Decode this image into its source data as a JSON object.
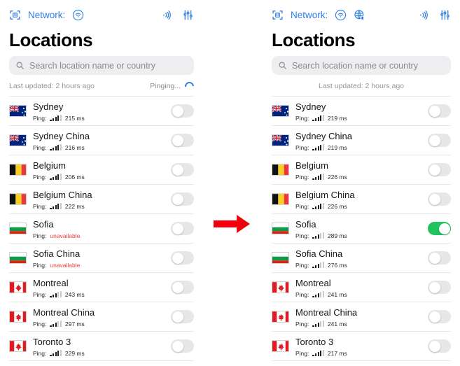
{
  "panels": {
    "left": {
      "topbar": {
        "scan_icon": "qr-scan-icon",
        "network_label": "Network:",
        "wifi_icon": "wifi-circle-icon",
        "globe_icon": null,
        "broadcast_icon": "broadcast-icon",
        "sliders_icon": "sliders-icon"
      },
      "title": "Locations",
      "search": {
        "placeholder": "Search location name or country",
        "value": ""
      },
      "status": {
        "updated": "Last updated: 2 hours ago",
        "pinging_label": "Pinging...",
        "show_spinner": true
      },
      "ping_prefix": "Ping:",
      "rows": [
        {
          "flag": "nz",
          "name": "Sydney",
          "ping": "215 ms",
          "bars": 4,
          "unavailable": false,
          "on": false
        },
        {
          "flag": "nz",
          "name": "Sydney China",
          "ping": "216 ms",
          "bars": 4,
          "unavailable": false,
          "on": false
        },
        {
          "flag": "be",
          "name": "Belgium",
          "ping": "206 ms",
          "bars": 4,
          "unavailable": false,
          "on": false
        },
        {
          "flag": "be",
          "name": "Belgium China",
          "ping": "222 ms",
          "bars": 4,
          "unavailable": false,
          "on": false
        },
        {
          "flag": "bg",
          "name": "Sofia",
          "ping": "unavailable",
          "bars": 0,
          "unavailable": true,
          "on": false
        },
        {
          "flag": "bg",
          "name": "Sofia China",
          "ping": "unavailable",
          "bars": 0,
          "unavailable": true,
          "on": false
        },
        {
          "flag": "ca",
          "name": "Montreal",
          "ping": "243 ms",
          "bars": 3,
          "unavailable": false,
          "on": false
        },
        {
          "flag": "ca",
          "name": "Montreal China",
          "ping": "297 ms",
          "bars": 3,
          "unavailable": false,
          "on": false
        },
        {
          "flag": "ca",
          "name": "Toronto 3",
          "ping": "229 ms",
          "bars": 4,
          "unavailable": false,
          "on": false
        }
      ]
    },
    "right": {
      "topbar": {
        "scan_icon": "qr-scan-icon",
        "network_label": "Network:",
        "wifi_icon": "wifi-circle-icon",
        "globe_icon": "globe-icon",
        "broadcast_icon": "broadcast-icon",
        "sliders_icon": "sliders-icon"
      },
      "title": "Locations",
      "search": {
        "placeholder": "Search location name or country",
        "value": ""
      },
      "status": {
        "updated": "Last updated: 2 hours ago",
        "pinging_label": "",
        "show_spinner": false
      },
      "ping_prefix": "Ping:",
      "rows": [
        {
          "flag": "nz",
          "name": "Sydney",
          "ping": "219 ms",
          "bars": 4,
          "unavailable": false,
          "on": false
        },
        {
          "flag": "nz",
          "name": "Sydney China",
          "ping": "219 ms",
          "bars": 4,
          "unavailable": false,
          "on": false
        },
        {
          "flag": "be",
          "name": "Belgium",
          "ping": "226 ms",
          "bars": 4,
          "unavailable": false,
          "on": false
        },
        {
          "flag": "be",
          "name": "Belgium China",
          "ping": "226 ms",
          "bars": 4,
          "unavailable": false,
          "on": false
        },
        {
          "flag": "bg",
          "name": "Sofia",
          "ping": "289 ms",
          "bars": 3,
          "unavailable": false,
          "on": true
        },
        {
          "flag": "bg",
          "name": "Sofia China",
          "ping": "276 ms",
          "bars": 3,
          "unavailable": false,
          "on": false
        },
        {
          "flag": "ca",
          "name": "Montreal",
          "ping": "241 ms",
          "bars": 3,
          "unavailable": false,
          "on": false
        },
        {
          "flag": "ca",
          "name": "Montreal China",
          "ping": "241 ms",
          "bars": 3,
          "unavailable": false,
          "on": false
        },
        {
          "flag": "ca",
          "name": "Toronto 3",
          "ping": "217 ms",
          "bars": 4,
          "unavailable": false,
          "on": false
        }
      ]
    }
  },
  "arrow": {
    "icon": "right-arrow-icon",
    "color": "#f4000d"
  },
  "colors": {
    "accent_blue": "#2f7fe0",
    "toggle_on_green": "#20c45d",
    "toggle_off_grey": "#e7e7ea",
    "unavailable_red": "#e8433c",
    "arrow_red": "#f4000d"
  }
}
